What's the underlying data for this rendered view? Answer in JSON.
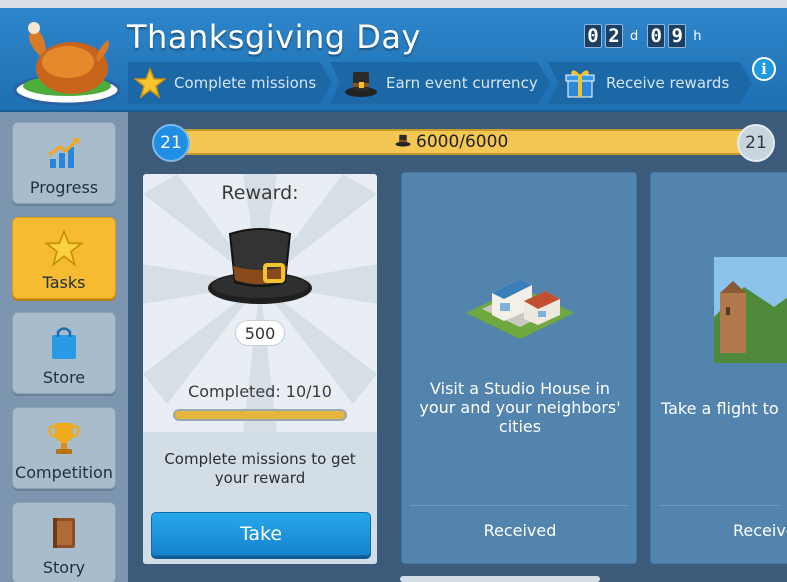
{
  "event": {
    "title": "Thanksgiving Day",
    "timer": {
      "days_digits": [
        "0",
        "2"
      ],
      "days_unit": "d",
      "hours_digits": [
        "0",
        "9"
      ],
      "hours_unit": "h"
    }
  },
  "steps": [
    {
      "label": "Complete missions",
      "icon": "star-icon"
    },
    {
      "label": "Earn event currency",
      "icon": "pilgrim-hat-icon"
    },
    {
      "label": "Receive rewards",
      "icon": "gift-icon"
    }
  ],
  "info_label": "i",
  "sidebar": {
    "items": [
      {
        "label": "Progress",
        "icon": "progress-chart-icon",
        "active": false
      },
      {
        "label": "Tasks",
        "icon": "star-icon",
        "active": true
      },
      {
        "label": "Store",
        "icon": "shopping-bag-icon",
        "active": false
      },
      {
        "label": "Competition",
        "icon": "trophy-icon",
        "active": false
      },
      {
        "label": "Story",
        "icon": "book-icon",
        "active": false
      }
    ]
  },
  "progress": {
    "current_level": "21",
    "next_level": "21",
    "text": "6000/6000",
    "fill_fraction": 1.0
  },
  "reward": {
    "label": "Reward:",
    "amount": "500",
    "completed": "Completed: 10/10",
    "completed_fraction": 1.0,
    "description": "Complete missions to get your reward",
    "take_label": "Take"
  },
  "tasks": [
    {
      "text": "Visit a Studio House in your and your neighbors' cities",
      "status": "Received",
      "image": "studio-house-image"
    },
    {
      "text": "Take a flight to",
      "status": "Receive",
      "image": "landscape-image"
    }
  ],
  "colors": {
    "accent_blue": "#1f8fe5",
    "gold": "#f7bb32",
    "header_blue": "#2f88cc"
  }
}
